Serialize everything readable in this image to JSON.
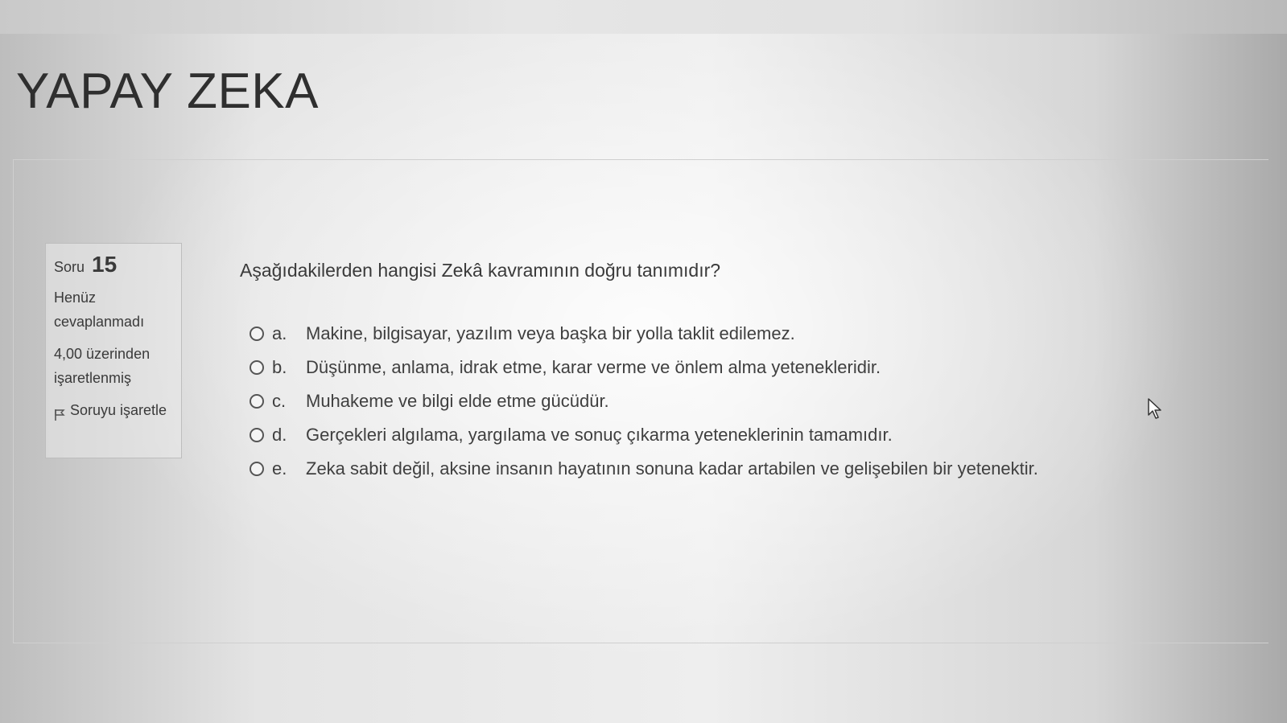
{
  "header": {
    "title": "YAPAY ZEKA"
  },
  "question_info": {
    "label": "Soru",
    "number": "15",
    "status": "Henüz cevaplanmadı",
    "grade": "4,00 üzerinden işaretlenmiş",
    "flag_label": "Soruyu işaretle",
    "flag_icon": "flag-icon"
  },
  "question": {
    "text": "Aşağıdakilerden hangisi Zekâ kavramının doğru tanımıdır?",
    "answers": [
      {
        "letter": "a.",
        "text": "Makine, bilgisayar, yazılım veya başka bir yolla taklit edilemez."
      },
      {
        "letter": "b.",
        "text": "Düşünme, anlama, idrak etme, karar verme ve önlem alma yetenekleridir."
      },
      {
        "letter": "c.",
        "text": "Muhakeme ve bilgi elde etme gücüdür."
      },
      {
        "letter": "d.",
        "text": "Gerçekleri algılama, yargılama ve sonuç çıkarma yeteneklerinin tamamıdır."
      },
      {
        "letter": "e.",
        "text": "Zeka sabit değil, aksine insanın hayatının sonuna kadar artabilen ve gelişebilen bir yetenektir."
      }
    ]
  }
}
